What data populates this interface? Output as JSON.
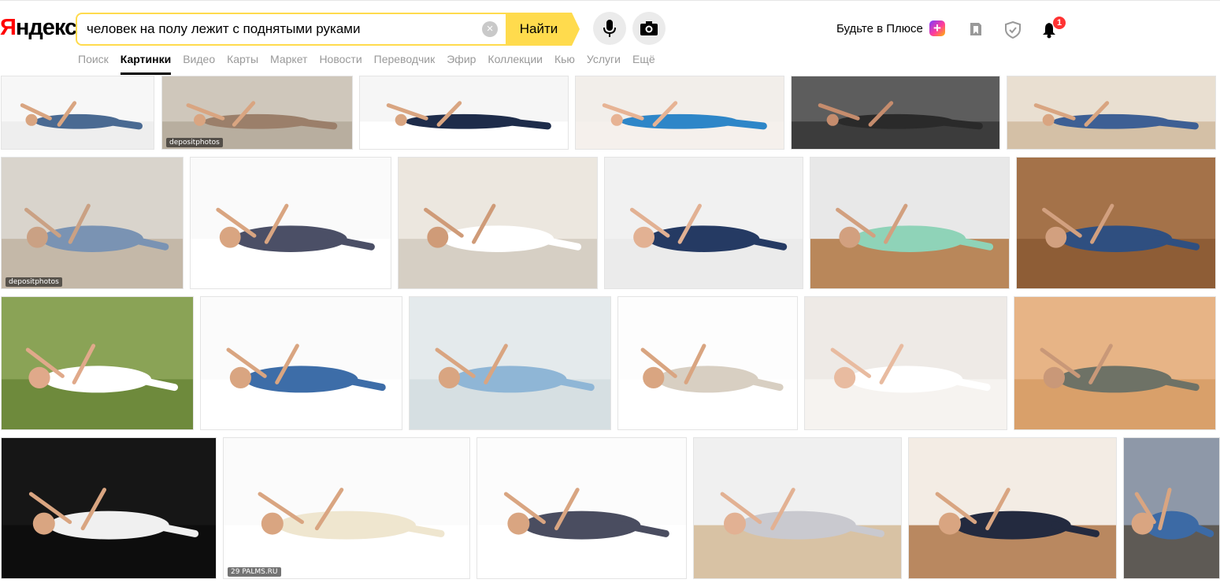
{
  "logo": {
    "first_letter": "Я",
    "rest": "ндекс"
  },
  "search": {
    "query": "человек на полу лежит с поднятыми руками",
    "find_label": "Найти",
    "clear_icon": "close-icon"
  },
  "header": {
    "plus_label": "Будьте в Плюсе",
    "notification_count": "1"
  },
  "tabs": [
    {
      "label": "Поиск",
      "active": false
    },
    {
      "label": "Картинки",
      "active": true
    },
    {
      "label": "Видео",
      "active": false
    },
    {
      "label": "Карты",
      "active": false
    },
    {
      "label": "Маркет",
      "active": false
    },
    {
      "label": "Новости",
      "active": false
    },
    {
      "label": "Переводчик",
      "active": false
    },
    {
      "label": "Эфир",
      "active": false
    },
    {
      "label": "Коллекции",
      "active": false
    },
    {
      "label": "Кью",
      "active": false
    },
    {
      "label": "Услуги",
      "active": false
    },
    {
      "label": "Ещё",
      "active": false
    }
  ],
  "results": [
    {
      "row": 0,
      "bg": "#f7f7f7",
      "floor": "#eeeeee",
      "figure": "#4a6a92",
      "skin": "#d9a581"
    },
    {
      "row": 0,
      "bg": "#cfc7bb",
      "floor": "#b8ae9f",
      "figure": "#9b7f6a",
      "skin": "#d9a581",
      "watermark": "depositphotos"
    },
    {
      "row": 0,
      "bg": "#f6f6f6",
      "floor": "#ffffff",
      "figure": "#1e2c4a",
      "skin": "#d9a581"
    },
    {
      "row": 0,
      "bg": "#f2eeea",
      "floor": "#f5f0ec",
      "figure": "#2e86c8",
      "skin": "#e7b394"
    },
    {
      "row": 0,
      "bg": "#5d5d5d",
      "floor": "#3c3c3c",
      "figure": "#2a2a2a",
      "skin": "#c58c6d"
    },
    {
      "row": 0,
      "bg": "#e9dfd1",
      "floor": "#d4c0a6",
      "figure": "#3d5f94",
      "skin": "#d9a581"
    },
    {
      "row": 1,
      "bg": "#d9d4cc",
      "floor": "#c4b8a8",
      "figure": "#7a93b3",
      "skin": "#caa184",
      "watermark": "depositphotos"
    },
    {
      "row": 1,
      "bg": "#fafafa",
      "floor": "#ffffff",
      "figure": "#4b4f66",
      "skin": "#d9a581"
    },
    {
      "row": 1,
      "bg": "#ece7df",
      "floor": "#d6cfc4",
      "figure": "#ffffff",
      "skin": "#cf9b78"
    },
    {
      "row": 1,
      "bg": "#f1f1f1",
      "floor": "#ebebeb",
      "figure": "#253a63",
      "skin": "#e2b193"
    },
    {
      "row": 1,
      "bg": "#e8e8e8",
      "floor": "#b9875a",
      "figure": "#8fd3b8",
      "skin": "#d2a07f"
    },
    {
      "row": 1,
      "bg": "#a47249",
      "floor": "#8e5d36",
      "figure": "#2f4f80",
      "skin": "#d2a07f"
    },
    {
      "row": 2,
      "bg": "#8aa356",
      "floor": "#6e8a3c",
      "figure": "#ffffff",
      "skin": "#e0a98a"
    },
    {
      "row": 2,
      "bg": "#fbfbfb",
      "floor": "#ffffff",
      "figure": "#3d6da8",
      "skin": "#d9a581"
    },
    {
      "row": 2,
      "bg": "#e4eaec",
      "floor": "#d6dfe2",
      "figure": "#8fb6d6",
      "skin": "#d9a581"
    },
    {
      "row": 2,
      "bg": "#fdfdfd",
      "floor": "#ffffff",
      "figure": "#d8cfc2",
      "skin": "#d9a581"
    },
    {
      "row": 2,
      "bg": "#eeeae6",
      "floor": "#f6f3f0",
      "figure": "#ffffff",
      "skin": "#e8bba0"
    },
    {
      "row": 2,
      "bg": "#e7b486",
      "floor": "#d9a06a",
      "figure": "#6e7266",
      "skin": "#c99878"
    },
    {
      "row": 3,
      "bg": "#161616",
      "floor": "#0d0d0d",
      "figure": "#f0f0f0",
      "skin": "#d9a581"
    },
    {
      "row": 3,
      "bg": "#fbfbfb",
      "floor": "#ffffff",
      "figure": "#efe6cf",
      "skin": "#d9a581",
      "watermark": "29 PALMS.RU"
    },
    {
      "row": 3,
      "bg": "#fcfcfc",
      "floor": "#ffffff",
      "figure": "#4a4d60",
      "skin": "#d9a581"
    },
    {
      "row": 3,
      "bg": "#f0f0f0",
      "floor": "#d8c2a4",
      "figure": "#c9c9cf",
      "skin": "#e2b193"
    },
    {
      "row": 3,
      "bg": "#f3ece4",
      "floor": "#b98860",
      "figure": "#232a3f",
      "skin": "#d9a581"
    },
    {
      "row": 3,
      "bg": "#8e98a8",
      "floor": "#5e5a55",
      "figure": "#3c6aa5",
      "skin": "#d9a581"
    }
  ]
}
